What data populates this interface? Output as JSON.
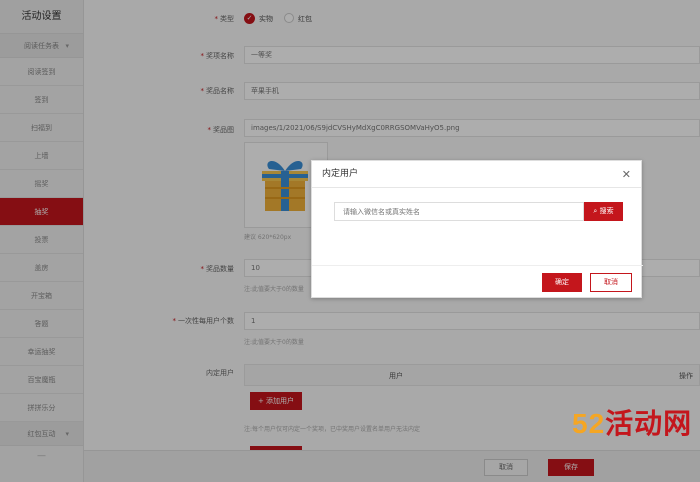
{
  "sidebar": {
    "title": "活动设置",
    "group1": "阅读任务表",
    "items": [
      "阅读签到",
      "签到",
      "扫福到",
      "上墙",
      "摇奖",
      "抽奖",
      "投票",
      "盖房",
      "开宝箱",
      "答题",
      "幸运抽奖",
      "百宝魔瓶",
      "拼拼乐分"
    ],
    "group2": "红包互动",
    "separator": "—"
  },
  "form": {
    "type_label": "类型",
    "type_option_physical": "实物",
    "type_option_redpacket": "红包",
    "prize_name_label": "奖项名称",
    "prize_name_value": "一等奖",
    "item_name_label": "奖品名称",
    "item_name_value": "苹果手机",
    "image_label": "奖品图",
    "image_path": "images/1/2021/06/S9jdCVSHyMdXgC0RRGSOMVaHyO5.png",
    "image_hint": "建议 620*620px",
    "quantity_label": "奖品数量",
    "quantity_value": "10",
    "quantity_hint": "注:此值要大于0的数量",
    "per_user_label": "一次性每用户个数",
    "per_user_value": "1",
    "per_user_hint": "注:此值要大于0的数量",
    "internal_user_label": "内定用户",
    "table_col_user": "用户",
    "table_col_action": "操作",
    "add_user_button": "添加用户",
    "add_user_hint": "注:每个用户仅可内定一个奖项，已中奖用户设置名单用户无法内定"
  },
  "footer": {
    "cancel_label": "取消",
    "save_label": "保存"
  },
  "dialog": {
    "title": "内定用户",
    "search_placeholder": "请输入微信名或真实姓名",
    "search_button": "搜索",
    "confirm_button": "确定",
    "cancel_button": "取消"
  },
  "watermark": {
    "number": "52",
    "text": "活动网"
  },
  "colors": {
    "accent": "#c4161c",
    "watermark_number": "#f5a623"
  },
  "icons": {
    "close": "close-icon",
    "search": "search-icon",
    "check": "check-icon",
    "plus": "plus-icon",
    "chevron": "chevron-down-icon"
  }
}
